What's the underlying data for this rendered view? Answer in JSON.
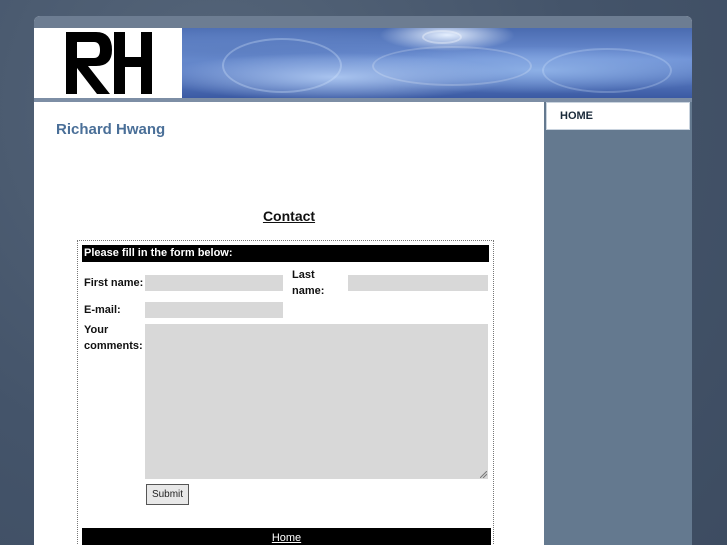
{
  "header": {
    "logo_text": "RH",
    "banner_image": "water-ripple-photo"
  },
  "site": {
    "name": "Richard Hwang"
  },
  "nav": {
    "items": [
      {
        "label": "HOME",
        "active": true
      }
    ]
  },
  "contact": {
    "title": "Contact",
    "form_header": "Please fill in the form below:",
    "first_name_label": "First name:",
    "last_name_label": "Last name:",
    "email_label": "E-mail:",
    "comments_label": "Your comments:",
    "first_name_value": "",
    "last_name_value": "",
    "email_value": "",
    "comments_value": "",
    "submit_label": "Submit"
  },
  "footer": {
    "link_label": "Home"
  },
  "colors": {
    "background": "#4a5a6e",
    "sidebar": "#64798f",
    "site_name": "#4a6f98",
    "field_bg": "#d8d8d8",
    "header_bar": "#000000"
  }
}
